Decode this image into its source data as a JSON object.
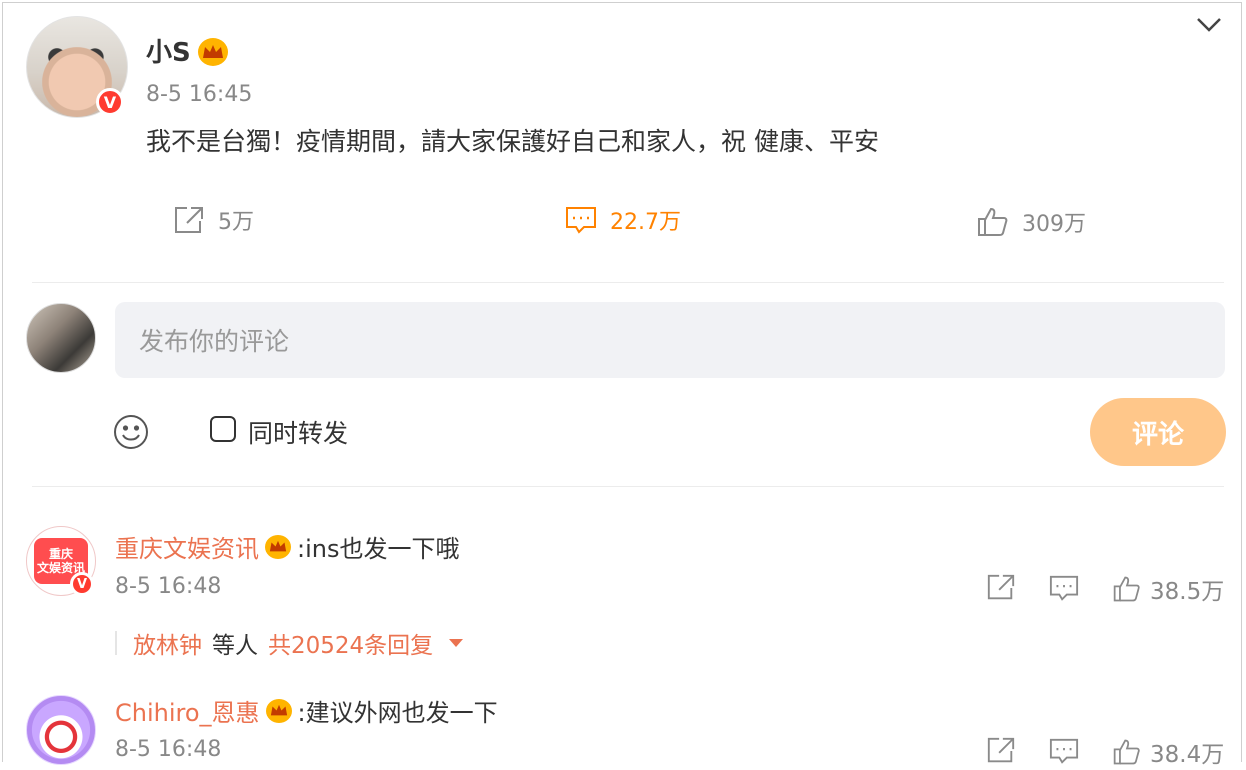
{
  "post": {
    "author": "小S",
    "verified_badge": "V",
    "vip_badge": "crown-icon",
    "time": "8-5 16:45",
    "text": "我不是台獨！疫情期間，請大家保護好自己和家人，祝 健康、平安",
    "actions": {
      "repost_count": "5万",
      "comment_count": "22.7万",
      "like_count": "309万"
    }
  },
  "compose": {
    "placeholder": "发布你的评论",
    "repost_label": "同时转发",
    "submit_label": "评论"
  },
  "comments": [
    {
      "author": "重庆文娱资讯",
      "avatar_text": "重庆\n文娱资讯",
      "text": ":ins也发一下哦",
      "time": "8-5 16:48",
      "like_count": "38.5万",
      "replies": {
        "who": "放林钟",
        "middle": "等人",
        "total": "共20524条回复"
      }
    },
    {
      "author": "Chihiro_恩惠",
      "text": ":建议外网也发一下",
      "time": "8-5 16:48",
      "like_count": "38.4万"
    }
  ],
  "colors": {
    "accent": "#ff8200",
    "name_link": "#eb7350",
    "submit_disabled": "#ffc78a",
    "verified": "#ff3b30",
    "vip": "#ffb400"
  }
}
